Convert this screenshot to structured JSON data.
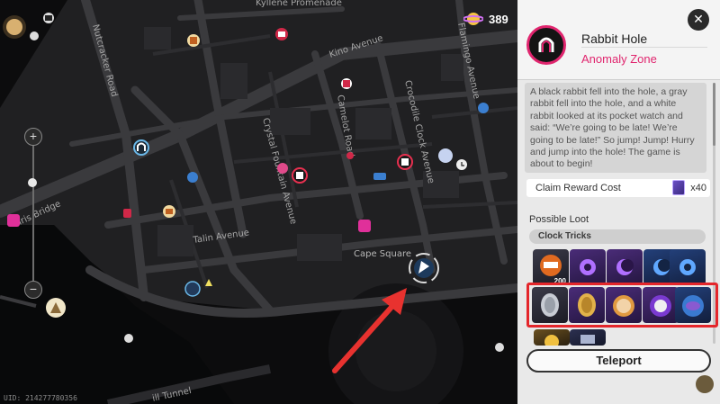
{
  "map": {
    "labels": {
      "kyllene": "Kyllene Promenade",
      "nutcracker": "Nutcracker Road",
      "kino": "Kino Avenue",
      "flamingo": "Flamingo Avenue",
      "camelot": "Camelot Road",
      "crocodile": "Crocodile Clock Avenue",
      "crystal": "Crystal Fountain Avenue",
      "talin": "Talin Avenue",
      "cape": "Cape Square",
      "bridge": "Iris Bridge",
      "tunnel": "ill Tunnel"
    },
    "uid": "UID: 214277780356",
    "counter_value": "389"
  },
  "panel": {
    "icon": "rabbit-hole-icon",
    "title": "Rabbit Hole",
    "subtitle": "Anomaly Zone",
    "description": "A black rabbit fell into the hole, a gray rabbit fell into the hole, and a white rabbit looked at its pocket watch and said: “We’re going to be late! We’re going to be late!” So jump! Jump! Hurry and jump into the hole! The game is about to begin!",
    "claim_label": "Claim Reward Cost",
    "claim_cost": "x40",
    "loot_title": "Possible Loot",
    "section": "Clock Tricks",
    "items_row1": [
      {
        "icon": "character-token-icon",
        "qty": "200"
      },
      {
        "icon": "purple-gear-icon"
      },
      {
        "icon": "purple-moon-icon"
      },
      {
        "icon": "blue-moon-icon"
      },
      {
        "icon": "blue-gear-icon"
      }
    ],
    "items_row2": [
      {
        "icon": "silver-coin-icon"
      },
      {
        "icon": "gold-coin-icon"
      },
      {
        "icon": "cat-badge-icon"
      },
      {
        "icon": "ghost-badge-icon"
      },
      {
        "icon": "planet-badge-icon"
      }
    ],
    "teleport_label": "Teleport",
    "accent": "#e0256e",
    "highlight_color": "#e4262b"
  }
}
